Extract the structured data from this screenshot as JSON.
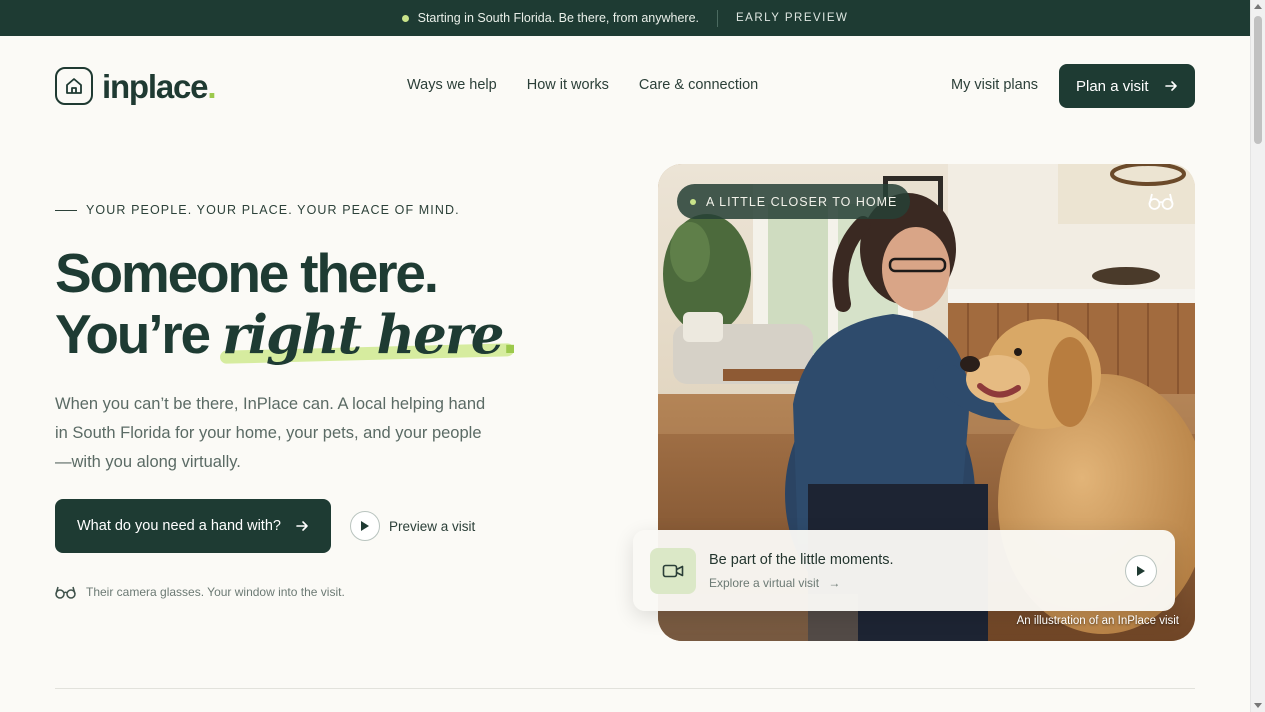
{
  "announcement": {
    "text": "Starting in South Florida. Be there, from anywhere.",
    "badge": "EARLY PREVIEW"
  },
  "header": {
    "brand": "inplace",
    "brand_dot": ".",
    "nav": [
      "Ways we help",
      "How it works",
      "Care & connection"
    ],
    "my_plans": "My visit plans",
    "cta_label": "Plan a visit",
    "cta_icon": "arrow-right-icon"
  },
  "hero": {
    "eyebrow": "YOUR PEOPLE. YOUR PLACE. YOUR PEACE OF MIND.",
    "headline_line1": "Someone there.",
    "headline_line2_prefix": "You’re ",
    "headline_line2_emphasis": "right here",
    "headline_line2_period": ".",
    "lede": "When you can’t be there, InPlace can. A local helping hand in South Florida for your home, your pets, and your people—with you along virtually.",
    "primary_cta": "What do you need a hand with?",
    "secondary_cta": "Preview a visit",
    "glasses_note": "Their camera glasses. Your window into the visit."
  },
  "photo": {
    "pill": "A LITTLE CLOSER TO HOME",
    "card_title": "Be part of the little moments.",
    "card_link": "Explore a virtual visit",
    "caption": "An illustration of an InPlace visit"
  },
  "colors": {
    "brand_dark": "#1e3b33",
    "accent_lime": "#9cc94c",
    "highlight": "#d6ec9f",
    "background": "#fbfaf6"
  }
}
